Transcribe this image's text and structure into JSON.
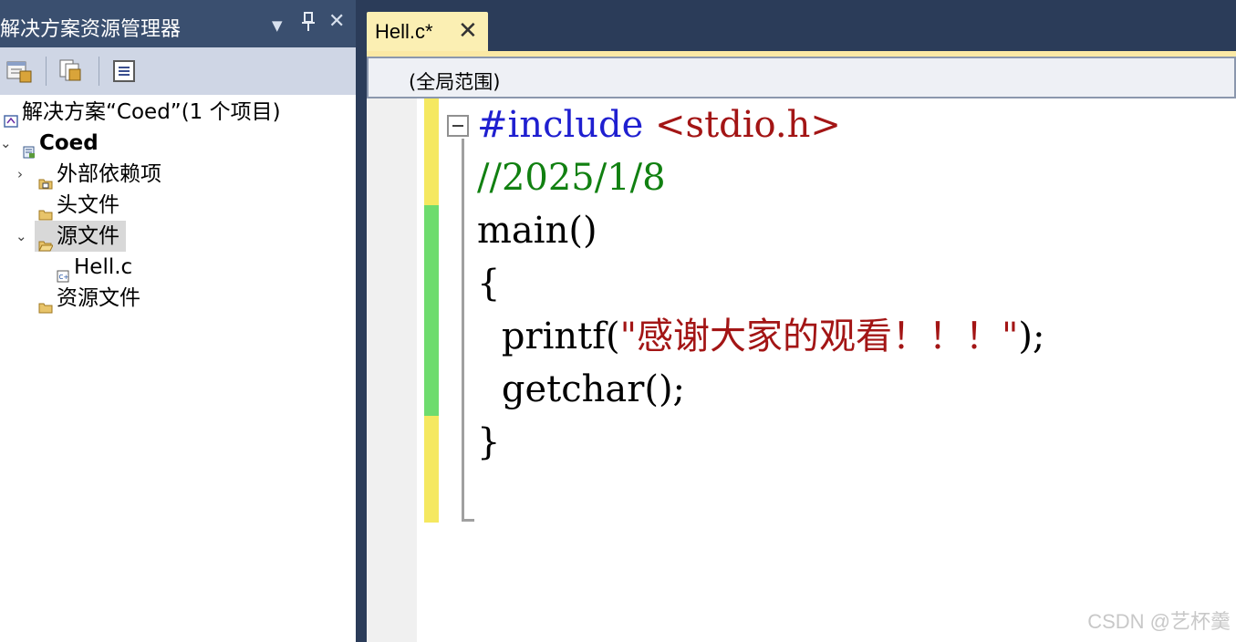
{
  "explorer": {
    "title": "解决方案资源管理器",
    "dropdown_icon": "▼",
    "pin_icon": "ᛋ",
    "close_icon": "✕",
    "tree": {
      "solution_label": "解决方案“Coed”(1 个项目)",
      "project_label": "Coed",
      "external_deps_label": "外部依赖项",
      "header_files_label": "头文件",
      "source_files_label": "源文件",
      "source_file_label": "Hell.c",
      "resource_files_label": "资源文件",
      "collapsed_glyph": "›",
      "expanded_glyph": "⌄"
    }
  },
  "editor": {
    "tab": {
      "label": "Hell.c*",
      "close_glyph": "✕"
    },
    "scope": "(全局范围)",
    "code": {
      "line1_directive": "#include",
      "line1_header": " <stdio.h>",
      "line2_comment": "//2025/1/8",
      "line3": "main()",
      "line4": "{",
      "line5_indent": "    printf(",
      "line5_string": "\"感谢大家的观看！！！\"",
      "line5_end": ");",
      "line6": "    getchar();",
      "line7": "}"
    }
  },
  "watermark": "CSDN @艺杯羹",
  "colors": {
    "keyword": "#1f1fd0",
    "string": "#a31515",
    "comment": "#118011",
    "changed_unsaved": "#f5e860",
    "changed_saved": "#6edc6e",
    "title_bar": "#3a4f6f",
    "tab": "#fbefb3"
  }
}
